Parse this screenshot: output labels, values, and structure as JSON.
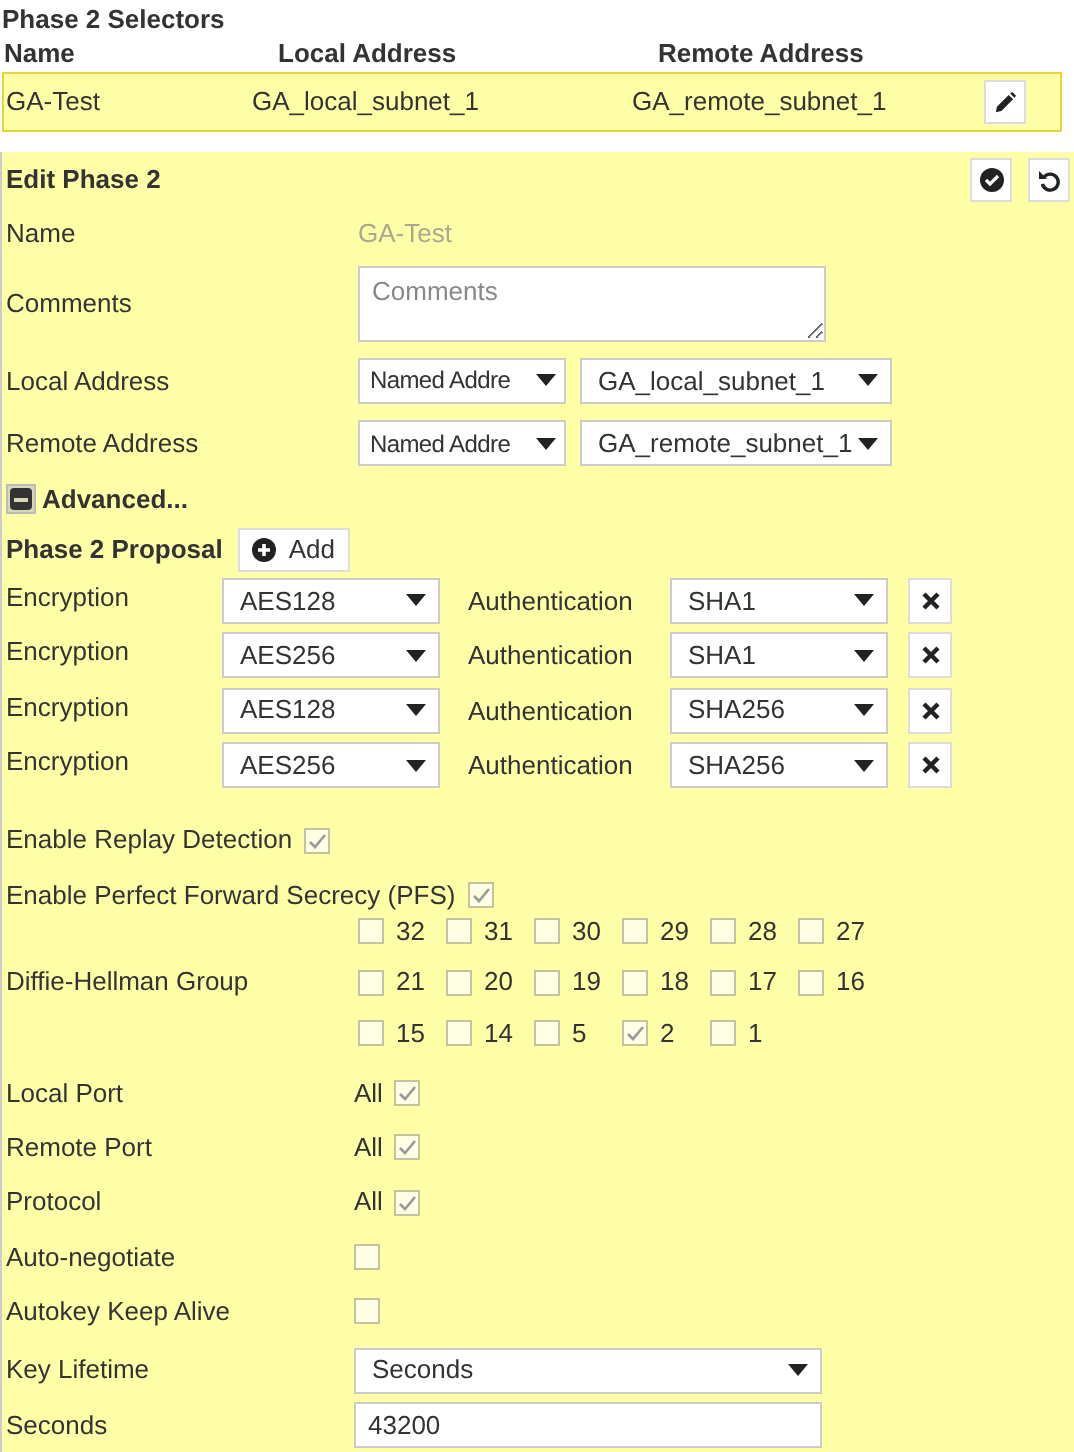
{
  "selectors": {
    "title": "Phase 2 Selectors",
    "columns": [
      "Name",
      "Local Address",
      "Remote Address"
    ],
    "rows": [
      {
        "name": "GA-Test",
        "local": "GA_local_subnet_1",
        "remote": "GA_remote_subnet_1",
        "selected": true
      }
    ]
  },
  "edit": {
    "title": "Edit Phase 2",
    "name": {
      "label": "Name",
      "value": "GA-Test"
    },
    "comments": {
      "label": "Comments",
      "placeholder": "Comments"
    },
    "addresses": [
      {
        "label": "Local Address",
        "type": "Named Addre",
        "address": "GA_local_subnet_1"
      },
      {
        "label": "Remote Address",
        "type": "Named Addre",
        "address": "GA_remote_subnet_1"
      }
    ],
    "advanced": {
      "label": "Advanced...",
      "expanded": true
    },
    "proposal": {
      "title": "Phase 2 Proposal",
      "add_label": "Add",
      "rows": [
        {
          "enc_label": "Encryption",
          "encryption": "AES128",
          "auth_label": "Authentication",
          "authentication": "SHA1"
        },
        {
          "enc_label": "Encryption",
          "encryption": "AES256",
          "auth_label": "Authentication",
          "authentication": "SHA1"
        },
        {
          "enc_label": "Encryption",
          "encryption": "AES128",
          "auth_label": "Authentication",
          "authentication": "SHA256"
        },
        {
          "enc_label": "Encryption",
          "encryption": "AES256",
          "auth_label": "Authentication",
          "authentication": "SHA256"
        }
      ]
    },
    "replay": {
      "label": "Enable Replay Detection",
      "checked": true
    },
    "pfs": {
      "label": "Enable Perfect Forward Secrecy (PFS)",
      "checked": true
    },
    "dh": {
      "label": "Diffie-Hellman Group",
      "groups": [
        {
          "label": "32",
          "checked": false
        },
        {
          "label": "31",
          "checked": false
        },
        {
          "label": "30",
          "checked": false
        },
        {
          "label": "29",
          "checked": false
        },
        {
          "label": "28",
          "checked": false
        },
        {
          "label": "27",
          "checked": false
        },
        {
          "label": "21",
          "checked": false
        },
        {
          "label": "20",
          "checked": false
        },
        {
          "label": "19",
          "checked": false
        },
        {
          "label": "18",
          "checked": false
        },
        {
          "label": "17",
          "checked": false
        },
        {
          "label": "16",
          "checked": false
        },
        {
          "label": "15",
          "checked": false
        },
        {
          "label": "14",
          "checked": false
        },
        {
          "label": "5",
          "checked": false
        },
        {
          "label": "2",
          "checked": true
        },
        {
          "label": "1",
          "checked": false
        }
      ]
    },
    "settings": [
      {
        "kind": "checkbox",
        "label": "Local Port",
        "prefix": "All",
        "checked": true
      },
      {
        "kind": "checkbox",
        "label": "Remote Port",
        "prefix": "All",
        "checked": true
      },
      {
        "kind": "checkbox",
        "label": "Protocol",
        "prefix": "All",
        "checked": true
      },
      {
        "kind": "checkbox",
        "label": "Auto-negotiate",
        "checked": false
      },
      {
        "kind": "checkbox",
        "label": "Autokey Keep Alive",
        "checked": false
      },
      {
        "kind": "select",
        "label": "Key Lifetime",
        "value": "Seconds"
      },
      {
        "kind": "input",
        "label": "Seconds",
        "value": "43200"
      }
    ]
  }
}
